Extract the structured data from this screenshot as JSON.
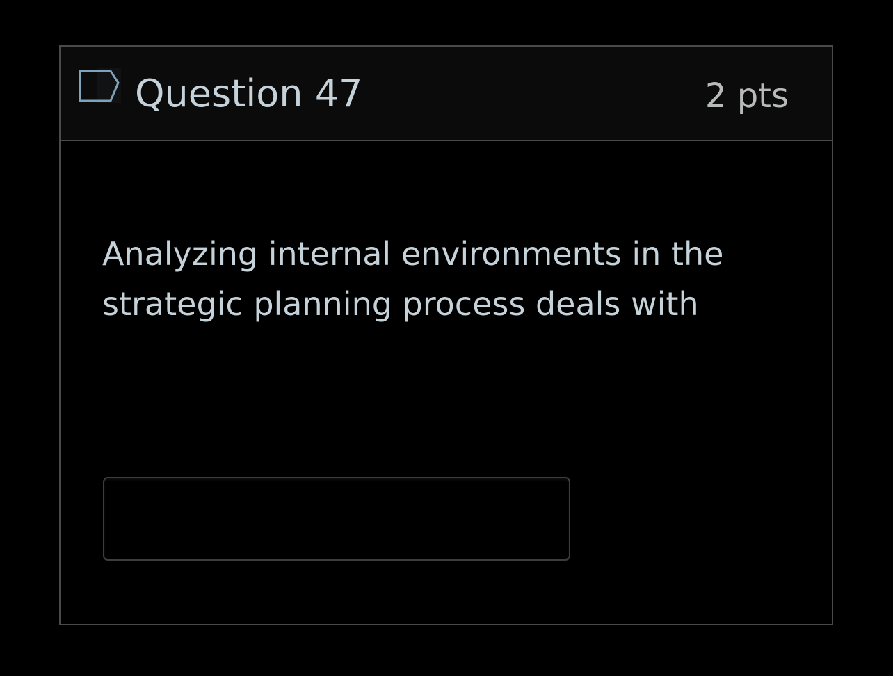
{
  "question": {
    "title": "Question 47",
    "points": "2 pts",
    "text": "Analyzing internal environments in the strategic planning process deals with",
    "flag_icon": "flag-outline-icon",
    "answer": {
      "value": "",
      "placeholder": ""
    }
  },
  "colors": {
    "background": "#000000",
    "header_background": "#0b0b0b",
    "border": "#4a4a4a",
    "text": "#c6d2da",
    "points_text": "#b7b9ba",
    "flag_outline": "#7fa3ba"
  }
}
